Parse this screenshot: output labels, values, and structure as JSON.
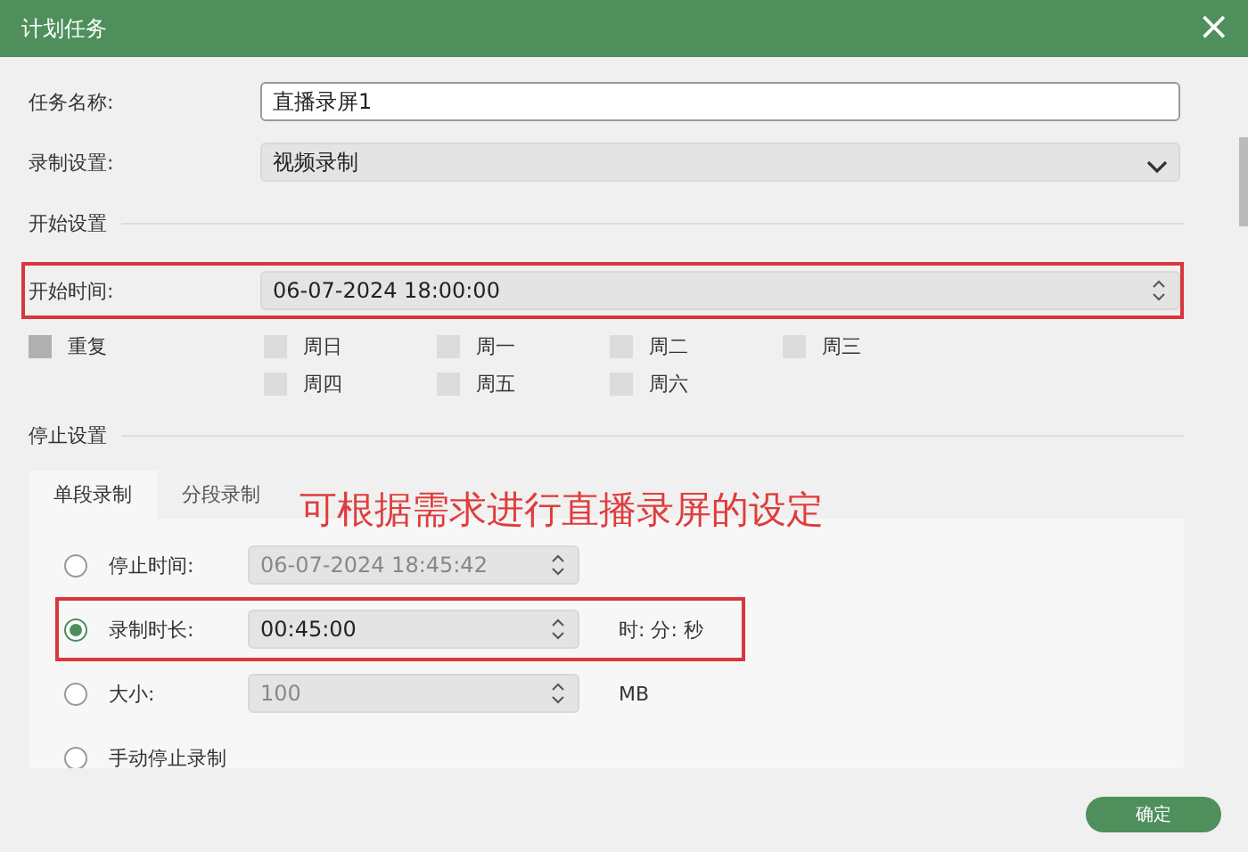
{
  "window": {
    "title": "计划任务",
    "close": "×"
  },
  "fields": [
    {
      "kind": "text",
      "label": "任务名称:",
      "value": "直播录屏1"
    },
    {
      "kind": "select",
      "label": "录制设置:",
      "value": "视频录制"
    }
  ],
  "start_section": {
    "title": "开始设置",
    "start_time": {
      "label": "开始时间:",
      "value": "06-07-2024 18:00:00",
      "highlighted": true
    },
    "repeat": {
      "label": "重复",
      "checked": false
    },
    "days": [
      {
        "label": "周日",
        "checked": false
      },
      {
        "label": "周一",
        "checked": false
      },
      {
        "label": "周二",
        "checked": false
      },
      {
        "label": "周三",
        "checked": false
      },
      {
        "label": "周四",
        "checked": false
      },
      {
        "label": "周五",
        "checked": false
      },
      {
        "label": "周六",
        "checked": false
      }
    ]
  },
  "stop_section": {
    "title": "停止设置",
    "annotation": "可根据需求进行直播录屏的设定",
    "tabs": [
      {
        "label": "单段录制",
        "selected": true
      },
      {
        "label": "分段录制",
        "selected": false
      }
    ],
    "options": [
      {
        "kind": "spin",
        "label": "停止时间:",
        "value": "06-07-2024 18:45:42",
        "disabled": true,
        "selected": false,
        "highlighted": false
      },
      {
        "kind": "spin",
        "label": "录制时长:",
        "value": "00:45:00",
        "unit": "时: 分: 秒",
        "disabled": false,
        "selected": true,
        "highlighted": true
      },
      {
        "kind": "spin",
        "label": "大小:",
        "value": "100",
        "unit": "MB",
        "disabled": true,
        "selected": false,
        "highlighted": false
      },
      {
        "kind": "plain",
        "label": "手动停止录制",
        "selected": false,
        "highlighted": false
      }
    ]
  },
  "buttons": [
    {
      "label": "确定"
    }
  ]
}
